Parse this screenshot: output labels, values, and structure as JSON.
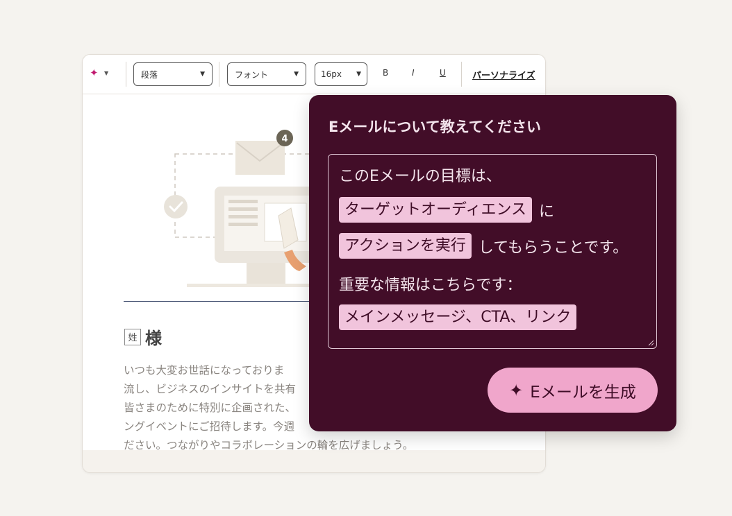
{
  "toolbar": {
    "ai_icon": "sparkle-icon",
    "paragraph_select": "段落",
    "font_select": "フォント",
    "size_select": "16px",
    "bold": "B",
    "italic": "I",
    "underline": "U",
    "personalize": "パーソナライズ"
  },
  "illustration": {
    "badge_count": "4"
  },
  "email": {
    "name_token": "姓",
    "salutation": "様",
    "body_lines": [
      "いつも大変お世話になっておりま",
      "流し、ビジネスのインサイトを共有",
      "皆さまのために特別に企画された、",
      "ングイベントにご招待します。今週",
      "ださい。つながりやコラボレーションの輪を広げましょう。"
    ]
  },
  "popup": {
    "title": "Eメールについて教えてください",
    "line1": "このEメールの目標は、",
    "chip_audience": "ターゲットオーディエンス",
    "after_audience": "に",
    "chip_action": "アクションを実行",
    "after_action": "してもらうことです。",
    "line4": "重要な情報はこちらです：",
    "chip_info": "メインメッセージ、CTA、リンク",
    "generate_button": "Eメールを生成"
  },
  "colors": {
    "popup_bg": "#420d28",
    "chip_bg": "#f1c4dc",
    "button_bg": "#f0a6cb",
    "accent": "#c0186e"
  }
}
